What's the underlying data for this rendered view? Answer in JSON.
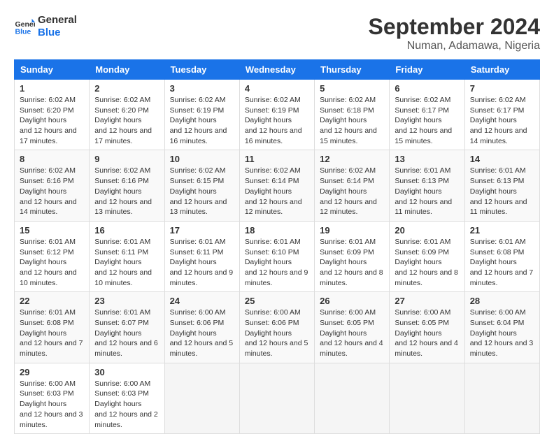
{
  "logo": {
    "line1": "General",
    "line2": "Blue"
  },
  "title": "September 2024",
  "subtitle": "Numan, Adamawa, Nigeria",
  "days_header": [
    "Sunday",
    "Monday",
    "Tuesday",
    "Wednesday",
    "Thursday",
    "Friday",
    "Saturday"
  ],
  "weeks": [
    [
      {
        "day": 1,
        "sunrise": "6:02 AM",
        "sunset": "6:20 PM",
        "daylight": "12 hours and 17 minutes."
      },
      {
        "day": 2,
        "sunrise": "6:02 AM",
        "sunset": "6:20 PM",
        "daylight": "12 hours and 17 minutes."
      },
      {
        "day": 3,
        "sunrise": "6:02 AM",
        "sunset": "6:19 PM",
        "daylight": "12 hours and 16 minutes."
      },
      {
        "day": 4,
        "sunrise": "6:02 AM",
        "sunset": "6:19 PM",
        "daylight": "12 hours and 16 minutes."
      },
      {
        "day": 5,
        "sunrise": "6:02 AM",
        "sunset": "6:18 PM",
        "daylight": "12 hours and 15 minutes."
      },
      {
        "day": 6,
        "sunrise": "6:02 AM",
        "sunset": "6:17 PM",
        "daylight": "12 hours and 15 minutes."
      },
      {
        "day": 7,
        "sunrise": "6:02 AM",
        "sunset": "6:17 PM",
        "daylight": "12 hours and 14 minutes."
      }
    ],
    [
      {
        "day": 8,
        "sunrise": "6:02 AM",
        "sunset": "6:16 PM",
        "daylight": "12 hours and 14 minutes."
      },
      {
        "day": 9,
        "sunrise": "6:02 AM",
        "sunset": "6:16 PM",
        "daylight": "12 hours and 13 minutes."
      },
      {
        "day": 10,
        "sunrise": "6:02 AM",
        "sunset": "6:15 PM",
        "daylight": "12 hours and 13 minutes."
      },
      {
        "day": 11,
        "sunrise": "6:02 AM",
        "sunset": "6:14 PM",
        "daylight": "12 hours and 12 minutes."
      },
      {
        "day": 12,
        "sunrise": "6:02 AM",
        "sunset": "6:14 PM",
        "daylight": "12 hours and 12 minutes."
      },
      {
        "day": 13,
        "sunrise": "6:01 AM",
        "sunset": "6:13 PM",
        "daylight": "12 hours and 11 minutes."
      },
      {
        "day": 14,
        "sunrise": "6:01 AM",
        "sunset": "6:13 PM",
        "daylight": "12 hours and 11 minutes."
      }
    ],
    [
      {
        "day": 15,
        "sunrise": "6:01 AM",
        "sunset": "6:12 PM",
        "daylight": "12 hours and 10 minutes."
      },
      {
        "day": 16,
        "sunrise": "6:01 AM",
        "sunset": "6:11 PM",
        "daylight": "12 hours and 10 minutes."
      },
      {
        "day": 17,
        "sunrise": "6:01 AM",
        "sunset": "6:11 PM",
        "daylight": "12 hours and 9 minutes."
      },
      {
        "day": 18,
        "sunrise": "6:01 AM",
        "sunset": "6:10 PM",
        "daylight": "12 hours and 9 minutes."
      },
      {
        "day": 19,
        "sunrise": "6:01 AM",
        "sunset": "6:09 PM",
        "daylight": "12 hours and 8 minutes."
      },
      {
        "day": 20,
        "sunrise": "6:01 AM",
        "sunset": "6:09 PM",
        "daylight": "12 hours and 8 minutes."
      },
      {
        "day": 21,
        "sunrise": "6:01 AM",
        "sunset": "6:08 PM",
        "daylight": "12 hours and 7 minutes."
      }
    ],
    [
      {
        "day": 22,
        "sunrise": "6:01 AM",
        "sunset": "6:08 PM",
        "daylight": "12 hours and 7 minutes."
      },
      {
        "day": 23,
        "sunrise": "6:01 AM",
        "sunset": "6:07 PM",
        "daylight": "12 hours and 6 minutes."
      },
      {
        "day": 24,
        "sunrise": "6:00 AM",
        "sunset": "6:06 PM",
        "daylight": "12 hours and 5 minutes."
      },
      {
        "day": 25,
        "sunrise": "6:00 AM",
        "sunset": "6:06 PM",
        "daylight": "12 hours and 5 minutes."
      },
      {
        "day": 26,
        "sunrise": "6:00 AM",
        "sunset": "6:05 PM",
        "daylight": "12 hours and 4 minutes."
      },
      {
        "day": 27,
        "sunrise": "6:00 AM",
        "sunset": "6:05 PM",
        "daylight": "12 hours and 4 minutes."
      },
      {
        "day": 28,
        "sunrise": "6:00 AM",
        "sunset": "6:04 PM",
        "daylight": "12 hours and 3 minutes."
      }
    ],
    [
      {
        "day": 29,
        "sunrise": "6:00 AM",
        "sunset": "6:03 PM",
        "daylight": "12 hours and 3 minutes."
      },
      {
        "day": 30,
        "sunrise": "6:00 AM",
        "sunset": "6:03 PM",
        "daylight": "12 hours and 2 minutes."
      },
      null,
      null,
      null,
      null,
      null
    ]
  ]
}
